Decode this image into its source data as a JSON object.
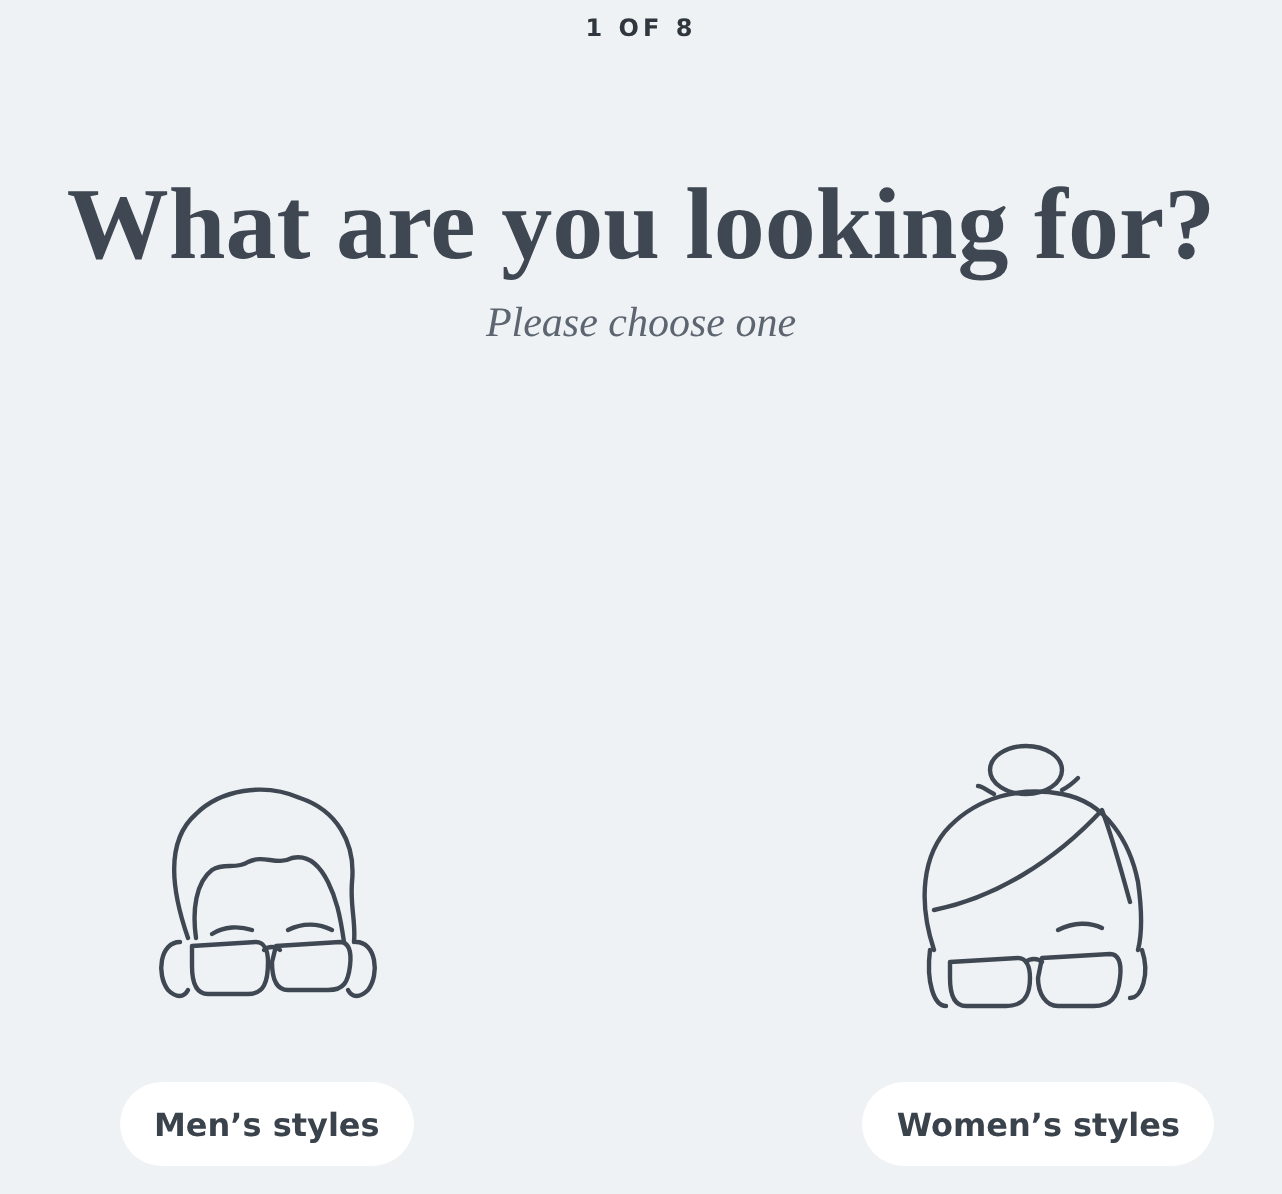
{
  "step": "1 OF 8",
  "title": "What are you looking for?",
  "subtitle": "Please choose one",
  "options": [
    {
      "kind": "men",
      "label": "Men’s styles"
    },
    {
      "kind": "women",
      "label": "Women’s styles"
    }
  ]
}
